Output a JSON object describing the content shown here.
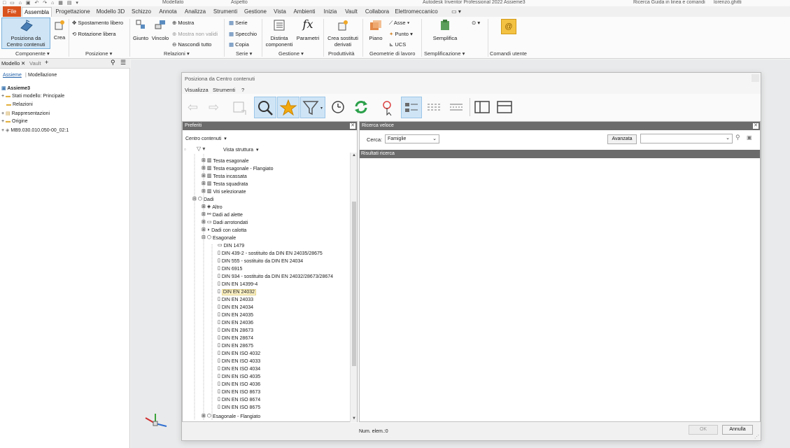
{
  "titlebar": {
    "workspace": "Modellato",
    "appearance": "Aspetto",
    "app_title": "Autodesk Inventor Professional 2022   Assieme3",
    "search": "Ricerca Guida in linea e comandi",
    "user": "lorenzo.ghitti"
  },
  "tabs": [
    "File",
    "Assembla",
    "Progettazione",
    "Modello 3D",
    "Schizzo",
    "Annota",
    "Analizza",
    "Strumenti",
    "Gestione",
    "Vista",
    "Ambienti",
    "Inizia",
    "Vault",
    "Collabora",
    "Elettromeccanico"
  ],
  "ribbon": {
    "place_label_1": "Posiziona da",
    "place_label_2": "Centro contenuti",
    "create": "Crea",
    "free_move": "Spostamento libero",
    "free_rotate": "Rotazione libera",
    "joint": "Giunto",
    "constraint": "Vincolo",
    "show": "Mostra",
    "show_sick": "Mostra non validi",
    "hide_all": "Nascondi tutto",
    "pattern": "Serie",
    "mirror": "Specchio",
    "copy": "Copia",
    "bom_1": "Distinta",
    "bom_2": "componenti",
    "parameters": "Parametri",
    "substitutes_1": "Crea sostituti",
    "substitutes_2": "derivati",
    "plane": "Piano",
    "axis": "Asse",
    "point": "Punto",
    "ucs": "UCS",
    "simplify": "Semplifica",
    "groups": {
      "component": "Componente",
      "position": "Posizione",
      "relationships": "Relazioni",
      "pattern": "Serie",
      "manage": "Gestione",
      "productivity": "Produttività",
      "work_features": "Geometrie di lavoro",
      "simplification": "Semplificazione",
      "user_commands": "Comandi utente"
    }
  },
  "browser": {
    "tab_model": "Modello",
    "tab_vault": "Vault",
    "view_assembly": "Assieme",
    "view_modeling": "Modellazione",
    "items": [
      "Assieme3",
      "Stati modello: Principale",
      "Relazioni",
      "Rappresentazioni",
      "Origine",
      "MB9.030.010.050-00_02:1"
    ]
  },
  "dialog": {
    "title": "Posiziona da Centro contenuti",
    "menu": [
      "Visualizza",
      "Strumenti",
      "?"
    ],
    "favorites": "Preferiti",
    "content_center": "Centro contenuti",
    "tree_view": "Vista struttura",
    "quick_search": "Ricerca veloce",
    "search_label": "Cerca:",
    "search_scope": "Famiglie",
    "advanced": "Avanzata",
    "results": "Risultati ricerca",
    "item_count": "Num. elem.:0",
    "ok": "OK",
    "cancel": "Annulla",
    "tree": [
      "Testa esagonale",
      "Testa esagonale - Flangiato",
      "Testa incassata",
      "Testa squadrata",
      "Viti selezionate",
      "Dadi",
      "Altro",
      "Dadi ad alette",
      "Dadi arrotondati",
      "Dadi con calotta",
      "Esagonale",
      "DIN 1479",
      "DIN 439-2 - sostituito da DIN EN 24035/28675",
      "DIN 555 - sostituito da DIN EN 24034",
      "DIN 6915",
      "DIN 934 - sostituito da DIN EN 24032/28673/28674",
      "DIN EN 14399-4",
      "DIN EN 24032",
      "DIN EN 24033",
      "DIN EN 24034",
      "DIN EN 24035",
      "DIN EN 24036",
      "DIN EN 28673",
      "DIN EN 28674",
      "DIN EN 28675",
      "DIN EN ISO 4032",
      "DIN EN ISO 4033",
      "DIN EN ISO 4034",
      "DIN EN ISO 4035",
      "DIN EN ISO 4036",
      "DIN EN ISO 8673",
      "DIN EN ISO 8674",
      "DIN EN ISO 8675",
      "Esagonale - Flangiato"
    ]
  },
  "colors": {
    "file_tab": "#d9531e",
    "selection": "#cfe5f6",
    "pane_header": "#6b6b6b"
  }
}
